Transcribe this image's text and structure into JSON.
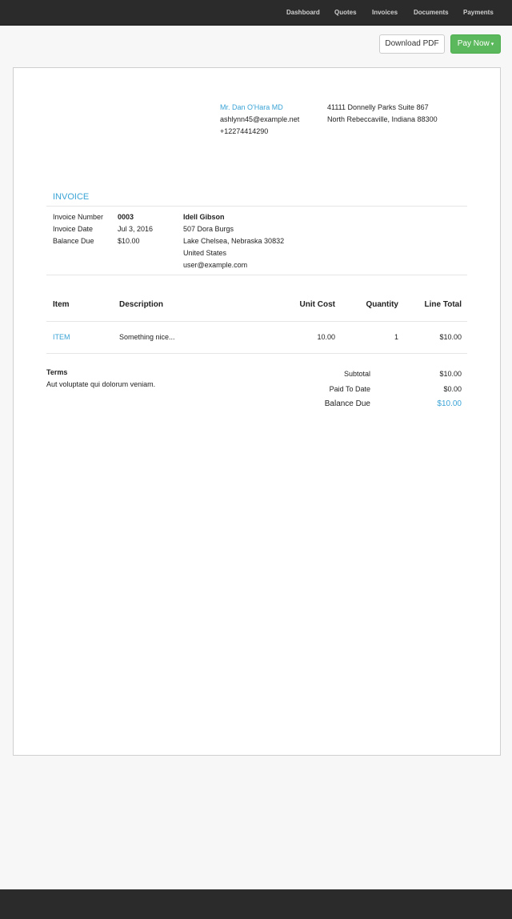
{
  "nav": {
    "dashboard": "Dashboard",
    "quotes": "Quotes",
    "invoices": "Invoices",
    "documents": "Documents",
    "payments": "Payments"
  },
  "actions": {
    "download_pdf": "Download PDF",
    "pay_now": "Pay Now",
    "pay_now_caret": "▾"
  },
  "company": {
    "contact_name": "Mr. Dan O'Hara MD",
    "email": "ashlynn45@example.net",
    "phone": "+12274414290",
    "address_line1": "41111 Donnelly Parks Suite 867",
    "address_line2": "North Rebeccaville, Indiana 88300"
  },
  "invoice": {
    "heading": "INVOICE",
    "number_label": "Invoice Number",
    "number_value": "0003",
    "date_label": "Invoice Date",
    "date_value": "Jul 3, 2016",
    "balance_label": "Balance Due",
    "balance_value": "$10.00"
  },
  "client": {
    "name": "Idell Gibson",
    "street": "507 Dora Burgs",
    "city_state": "Lake Chelsea, Nebraska 30832",
    "country": "United States",
    "email": "user@example.com"
  },
  "table": {
    "headers": {
      "item": "Item",
      "description": "Description",
      "unit_cost": "Unit Cost",
      "quantity": "Quantity",
      "line_total": "Line Total"
    },
    "rows": [
      {
        "item": "ITEM",
        "description": "Something nice...",
        "unit_cost": "10.00",
        "quantity": "1",
        "line_total": "$10.00"
      }
    ]
  },
  "terms": {
    "label": "Terms",
    "text": "Aut voluptate qui dolorum veniam."
  },
  "totals": {
    "subtotal_label": "Subtotal",
    "subtotal_value": "$10.00",
    "paid_label": "Paid To Date",
    "paid_value": "$0.00",
    "balance_label": "Balance Due",
    "balance_value": "$10.00"
  },
  "colors": {
    "accent": "#3aa3d6",
    "pay_button": "#5cb85c",
    "nav_background": "#2b2b2b"
  }
}
